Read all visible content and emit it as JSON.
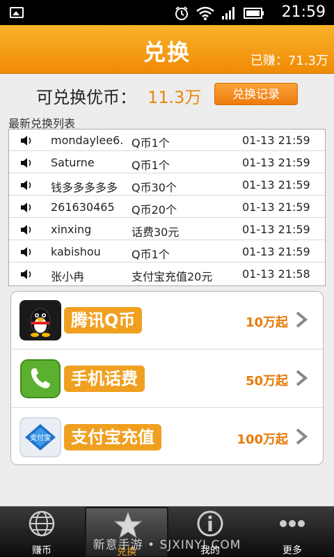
{
  "status_bar": {
    "time": "21:59"
  },
  "header": {
    "title": "兑换",
    "earned": "已赚：71.3万"
  },
  "balance": {
    "label": "可兑换优币：",
    "value": "11.3万",
    "record_button": "兑换记录"
  },
  "list": {
    "title": "最新兑换列表",
    "rows": [
      {
        "user": "mondaylee6.",
        "item": "Q币1个",
        "time": "01-13 21:59"
      },
      {
        "user": "Saturne",
        "item": "Q币1个",
        "time": "01-13 21:59"
      },
      {
        "user": "钱多多多多多",
        "item": "Q币30个",
        "time": "01-13 21:59"
      },
      {
        "user": "261630465",
        "item": "Q币20个",
        "time": "01-13 21:59"
      },
      {
        "user": "xinxing",
        "item": "话费30元",
        "time": "01-13 21:59"
      },
      {
        "user": "kabishou",
        "item": "Q币1个",
        "time": "01-13 21:59"
      },
      {
        "user": "张小冉",
        "item": "支付宝充值20元",
        "time": "01-13 21:58"
      }
    ]
  },
  "options": [
    {
      "name": "腾讯Q币",
      "price": "10万起",
      "icon": "qq-penguin-icon"
    },
    {
      "name": "手机话费",
      "price": "50万起",
      "icon": "phone-icon"
    },
    {
      "name": "支付宝充值",
      "price": "100万起",
      "icon": "alipay-icon",
      "logo_text": "支付宝"
    }
  ],
  "tabs": [
    {
      "label": "赚币",
      "icon": "globe-icon"
    },
    {
      "label": "兑换",
      "icon": "star-icon",
      "active": true
    },
    {
      "label": "我的",
      "icon": "info-icon"
    },
    {
      "label": "更多",
      "icon": "more-dots-icon"
    }
  ],
  "watermark": "新意手游 • SJXINYI.COM",
  "colors": {
    "accent": "#f08a05",
    "price": "#e87a05",
    "tab_active": "#f2a92a"
  }
}
